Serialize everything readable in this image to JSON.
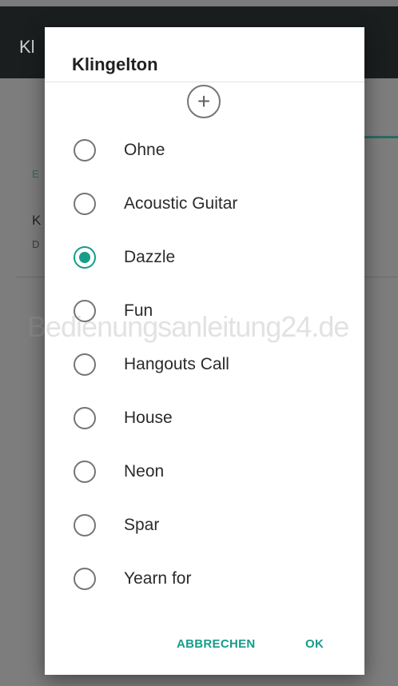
{
  "background_app": {
    "title": "Kl",
    "section_label": "E",
    "item_title": "K",
    "item_subtitle": "D"
  },
  "dialog": {
    "title": "Klingelton",
    "add_icon": "plus-circle-icon",
    "add_glyph": "+",
    "options": [
      {
        "label": "Ohne",
        "selected": false
      },
      {
        "label": "Acoustic Guitar",
        "selected": false
      },
      {
        "label": "Dazzle",
        "selected": true
      },
      {
        "label": "Fun",
        "selected": false
      },
      {
        "label": "Hangouts Call",
        "selected": false
      },
      {
        "label": "House",
        "selected": false
      },
      {
        "label": "Neon",
        "selected": false
      },
      {
        "label": "Spar",
        "selected": false
      },
      {
        "label": "Yearn for",
        "selected": false
      }
    ],
    "cancel_label": "ABBRECHEN",
    "ok_label": "OK"
  },
  "watermark": "Bedienungsanleitung24.de",
  "colors": {
    "accent": "#169c8a",
    "appbar": "#1b1e1f"
  }
}
